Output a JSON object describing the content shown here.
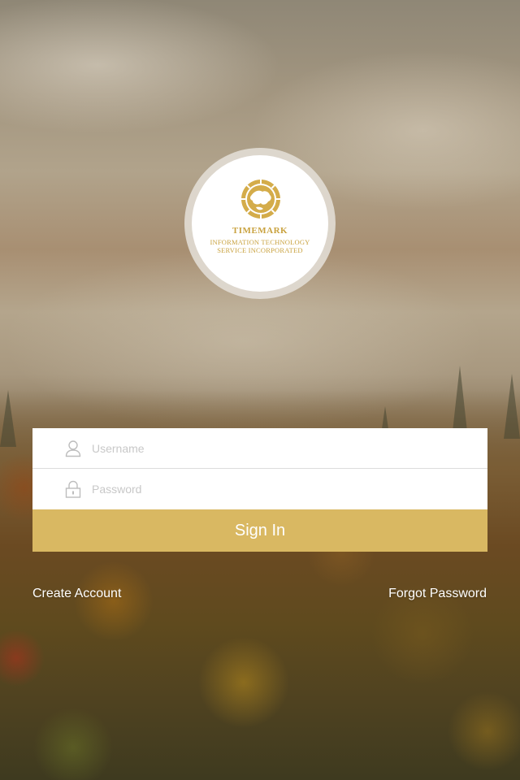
{
  "logo": {
    "name": "TIMEMARK",
    "subtitle_line1": "INFORMATION TECHNOLOGY",
    "subtitle_line2": "SERVICE INCORPORATED",
    "emblem_icon": "globe-clock-icon",
    "color": "#c9a23f"
  },
  "login_form": {
    "username": {
      "placeholder": "Username",
      "value": "",
      "icon": "user-icon"
    },
    "password": {
      "placeholder": "Password",
      "value": "",
      "icon": "lock-icon"
    },
    "sign_in_label": "Sign In"
  },
  "links": {
    "create_account": "Create Account",
    "forgot_password": "Forgot Password"
  },
  "colors": {
    "accent": "#d9b862",
    "field_background": "#ffffff",
    "placeholder": "#c8c8c8",
    "link_text": "#ffffff"
  }
}
